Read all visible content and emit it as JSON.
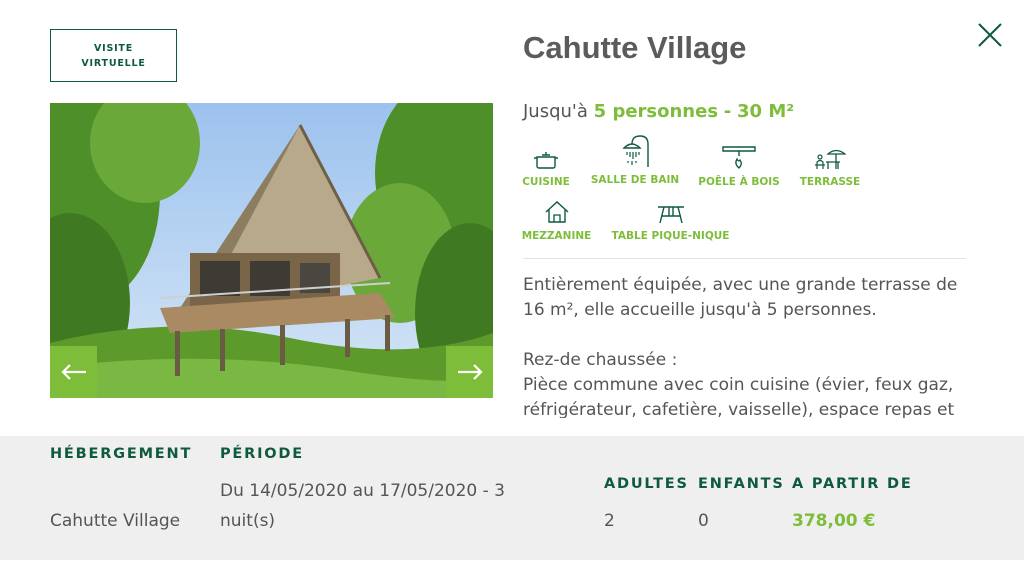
{
  "header": {
    "virtual_tour_label": "VISITE\nVIRTUELLE",
    "title": "Cahutte Village",
    "close_icon": "close-icon"
  },
  "gallery": {
    "prev_icon": "arrow-left-icon",
    "next_icon": "arrow-right-icon"
  },
  "capacity": {
    "prefix": "Jusqu'à",
    "persons": "5 personnes",
    "separator": "-",
    "surface": "30 M²"
  },
  "amenities": [
    {
      "label": "CUISINE",
      "icon": "cooking-pot-icon"
    },
    {
      "label": "SALLE DE BAIN",
      "icon": "shower-icon"
    },
    {
      "label": "POÊLE À BOIS",
      "icon": "wood-stove-icon"
    },
    {
      "label": "TERRASSE",
      "icon": "terrace-icon"
    },
    {
      "label": "MEZZANINE",
      "icon": "house-icon"
    },
    {
      "label": "TABLE PIQUE-NIQUE",
      "icon": "picnic-table-icon"
    }
  ],
  "description": {
    "p1": "Entièrement équipée, avec une grande terrasse de 16 m², elle accueille jusqu'à 5 personnes.",
    "p2_title": "Rez-de chaussée :",
    "p2_text": "Pièce commune avec coin cuisine (évier, feux gaz, réfrigérateur, cafetière, vaisselle), espace repas et salle"
  },
  "booking": {
    "headers": {
      "accommodation": "HÉBERGEMENT",
      "period": "PÉRIODE",
      "adults": "ADULTES",
      "children": "ENFANTS",
      "price_from": "A PARTIR DE"
    },
    "values": {
      "accommodation": "Cahutte Village",
      "period_line1": "Du 14/05/2020 au 17/05/2020 - 3",
      "period_line2": "nuit(s)",
      "adults": "2",
      "children": "0",
      "price": "378,00 €"
    }
  },
  "colors": {
    "accent_green": "#7dbd3a",
    "dark_green": "#0e5a3c",
    "bar_bg": "#efefef"
  }
}
